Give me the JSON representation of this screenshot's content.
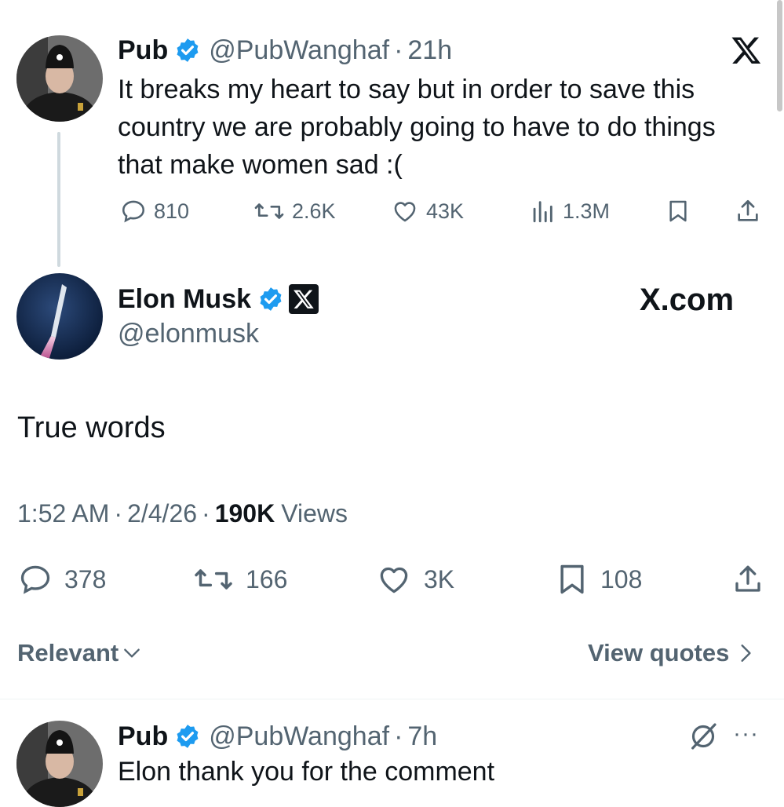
{
  "original_tweet": {
    "display_name": "Pub",
    "handle": "@PubWanghaf",
    "separator": "·",
    "time": "21h",
    "text": "It breaks my heart to say but in order to save this country we are probably going to have to do things that make women sad :(",
    "replies": "810",
    "reposts": "2.6K",
    "likes": "43K",
    "views": "1.3M",
    "logo_icon": "x-logo-icon"
  },
  "main_tweet": {
    "display_name": "Elon Musk",
    "handle": "@elonmusk",
    "affiliate_link": "X.com",
    "text": "True words",
    "time": "1:52 AM",
    "separator": "·",
    "date": "2/4/26",
    "views_count": "190K",
    "views_label": "Views",
    "replies": "378",
    "reposts": "166",
    "likes": "3K",
    "bookmarks": "108"
  },
  "sort_bar": {
    "sort_label": "Relevant",
    "quotes_label": "View quotes"
  },
  "reply_tweet": {
    "display_name": "Pub",
    "handle": "@PubWanghaf",
    "separator": "·",
    "time": "7h",
    "text": "Elon thank you for the comment",
    "more_label": "···"
  },
  "colors": {
    "verified_blue": "#1d9bf0",
    "text_primary": "#0f1419",
    "text_secondary": "#536471",
    "divider": "#eff3f4"
  }
}
